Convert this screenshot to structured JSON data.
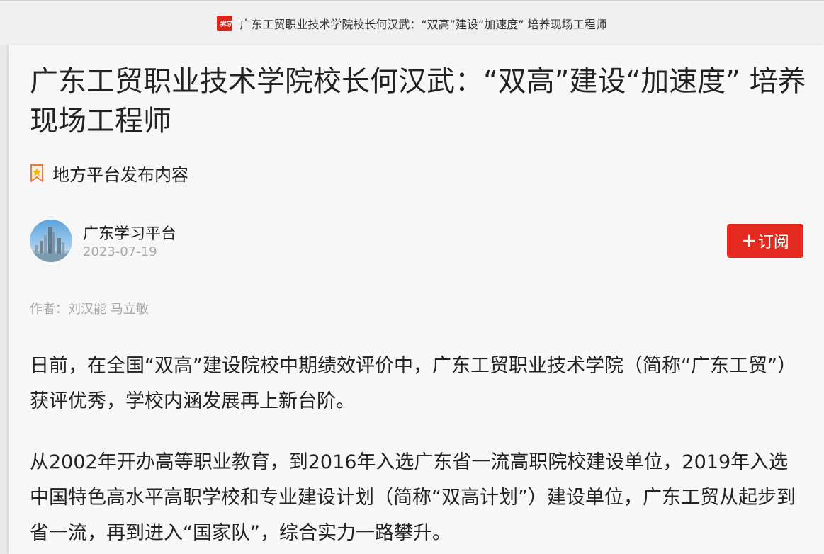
{
  "browser": {
    "tab_icon": "xuexi-logo-icon",
    "tab_icon_text": "学习",
    "tab_title": "广东工贸职业技术学院校长何汉武：“双高”建设“加速度” 培养现场工程师"
  },
  "article": {
    "title": "广东工贸职业技术学院校长何汉武：“双高”建设“加速度” 培养现场工程师",
    "source_tag": "地方平台发布内容",
    "publisher": "广东学习平台",
    "date": "2023-07-19",
    "subscribe_label": "订阅",
    "byline": "作者：刘汉能 马立敏",
    "paragraphs": [
      "日前，在全国“双高”建设院校中期绩效评价中，广东工贸职业技术学院（简称“广东工贸”）获评优秀，学校内涵发展再上新台阶。",
      "从2002年开办高等职业教育，到2016年入选广东省一流高职院校建设单位，2019年入选中国特色高水平高职学校和专业建设计划（简称“双高计划”）建设单位，广东工贸从起步到省一流，再到进入“国家队”，综合实力一路攀升。"
    ]
  },
  "colors": {
    "accent": "#e42a20",
    "text": "#222222",
    "muted": "#a8a8a8",
    "background": "#f7f7f7"
  }
}
